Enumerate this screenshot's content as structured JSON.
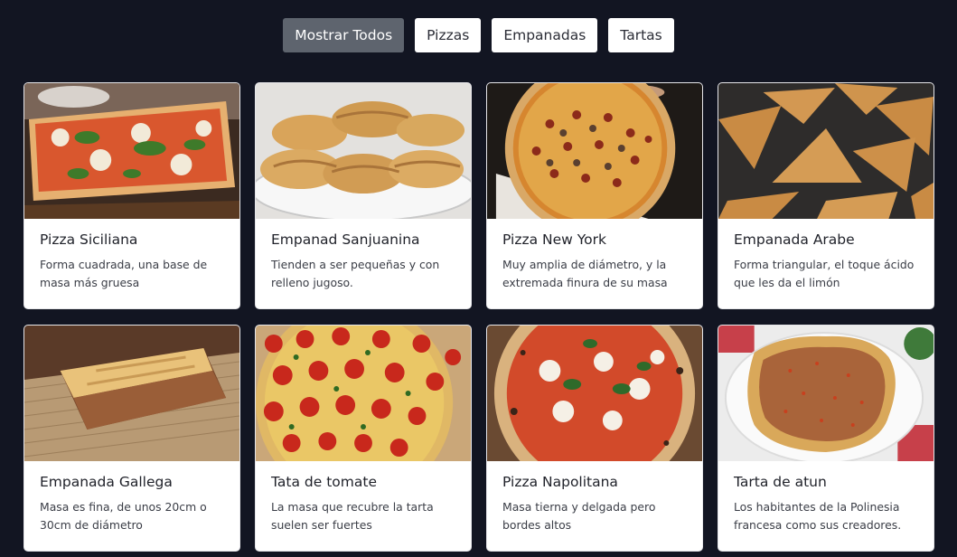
{
  "filters": [
    {
      "label": "Mostrar Todos",
      "active": true
    },
    {
      "label": "Pizzas",
      "active": false
    },
    {
      "label": "Empanadas",
      "active": false
    },
    {
      "label": "Tartas",
      "active": false
    }
  ],
  "cards": [
    {
      "title": "Pizza Siciliana",
      "description": "Forma cuadrada, una base de masa más gruesa",
      "image": "pizza-siciliana-photo"
    },
    {
      "title": "Empanad Sanjuanina",
      "description": "Tienden a ser pequeñas y con relleno jugoso.",
      "image": "empanadas-sanjuaninas-photo"
    },
    {
      "title": "Pizza New York",
      "description": "Muy amplia de diámetro, y la extremada finura de su masa",
      "image": "pizza-new-york-photo"
    },
    {
      "title": "Empanada Arabe",
      "description": "Forma triangular, el toque ácido que les da el limón",
      "image": "empanadas-arabes-photo"
    },
    {
      "title": "Empanada Gallega",
      "description": "Masa es fina, de unos 20cm o 30cm de diámetro",
      "image": "empanada-gallega-photo"
    },
    {
      "title": "Tata de tomate",
      "description": "La masa que recubre la tarta suelen ser fuertes",
      "image": "tarta-de-tomate-photo"
    },
    {
      "title": "Pizza Napolitana",
      "description": "Masa tierna y delgada pero bordes altos",
      "image": "pizza-napolitana-photo"
    },
    {
      "title": "Tarta de atun",
      "description": "Los habitantes de la Polinesia francesa como sus creadores.",
      "image": "tarta-de-atun-photo"
    }
  ]
}
